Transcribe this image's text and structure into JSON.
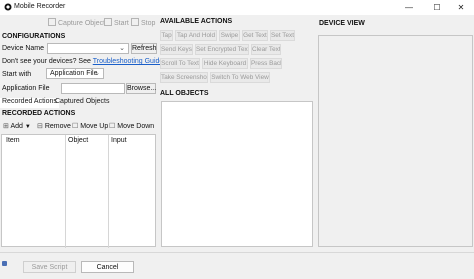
{
  "window": {
    "title": "Mobile Recorder",
    "minimize": "—",
    "maximize": "☐",
    "close": "✕"
  },
  "toolbar": {
    "capture": "Capture Object",
    "start": "Start",
    "stop": "Stop"
  },
  "config": {
    "heading": "CONFIGURATIONS",
    "device_name_label": "Device Name",
    "device_name_value": "",
    "refresh": "Refresh",
    "help_text": "Don't see your devices? See ",
    "help_link": "Troubleshooting Guide.",
    "start_with_label": "Start with",
    "start_with_value": "Application File",
    "app_file_label": "Application File",
    "app_file_value": "",
    "browse": "Browse..."
  },
  "tabs": [
    "Recorded Actions",
    "Captured Objects"
  ],
  "recorded": {
    "heading": "RECORDED ACTIONS",
    "add": "Add",
    "remove": "Remove",
    "move_up": "Move Up",
    "move_down": "Move Down",
    "columns": [
      "Item",
      "Object",
      "Input"
    ]
  },
  "actions": {
    "heading": "AVAILABLE ACTIONS",
    "items": [
      "Tap",
      "Tap And Hold",
      "Swipe",
      "Get Text",
      "Set Text",
      "Send Keys",
      "Set Encrypted Text",
      "Clear Text",
      "Scroll To Text",
      "Hide Keyboard",
      "Press Back",
      "Take Screenshot",
      "Switch To Web View"
    ]
  },
  "all_objects": {
    "heading": "ALL OBJECTS"
  },
  "device_view": {
    "heading": "DEVICE VIEW"
  },
  "footer": {
    "save": "Save Script",
    "cancel": "Cancel"
  }
}
